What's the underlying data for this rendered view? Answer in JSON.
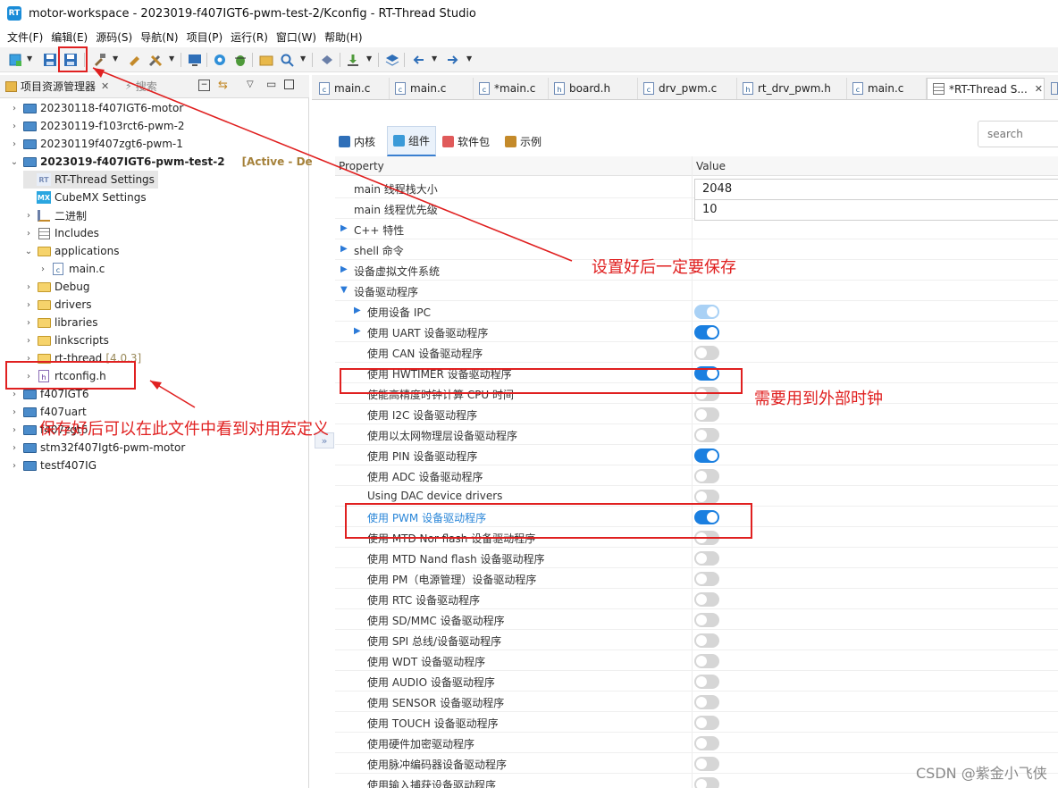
{
  "window": {
    "title": "motor-workspace - 2023019-f407IGT6-pwm-test-2/Kconfig - RT-Thread Studio",
    "logo_text": "RT"
  },
  "menubar": [
    "文件(F)",
    "编辑(E)",
    "源码(S)",
    "导航(N)",
    "项目(P)",
    "运行(R)",
    "窗口(W)",
    "帮助(H)"
  ],
  "toolbar": {
    "icons": [
      "new-icon",
      "save-icon",
      "save-all-icon",
      "build-icon",
      "clean-icon",
      "tools-icon",
      "terminal-icon",
      "settings-icon",
      "debug-icon",
      "open-folder-icon",
      "search-icon",
      "sdk-icon",
      "download-icon",
      "layers-icon",
      "back-icon",
      "forward-icon"
    ]
  },
  "left_panel": {
    "tab_label": "项目资源管理器",
    "tab_close": "✕",
    "search_tab": "搜索",
    "tree": [
      {
        "label": "20230118-f407IGT6-motor",
        "type": "project"
      },
      {
        "label": "20230119-f103rct6-pwm-2",
        "type": "project"
      },
      {
        "label": "20230119f407zgt6-pwm-1",
        "type": "project"
      },
      {
        "label": "2023019-f407IGT6-pwm-test-2",
        "type": "project",
        "badge": "[Active - Debug]"
      },
      {
        "label": "RT-Thread Settings",
        "type": "rt-settings",
        "icon_text": "RT"
      },
      {
        "label": "CubeMX Settings",
        "type": "cubemx",
        "icon_text": "MX"
      },
      {
        "label": "二进制",
        "type": "binaries"
      },
      {
        "label": "Includes",
        "type": "includes"
      },
      {
        "label": "applications",
        "type": "folder"
      },
      {
        "label": "main.c",
        "type": "cfile",
        "icon_text": "c"
      },
      {
        "label": "Debug",
        "type": "folder"
      },
      {
        "label": "drivers",
        "type": "folder"
      },
      {
        "label": "libraries",
        "type": "folder"
      },
      {
        "label": "linkscripts",
        "type": "folder"
      },
      {
        "label": "rt-thread",
        "type": "folder",
        "suffix": "[4.0.3]"
      },
      {
        "label": "rtconfig.h",
        "type": "hfile",
        "icon_text": "h"
      },
      {
        "label": "f407IGT6",
        "type": "project"
      },
      {
        "label": "f407uart",
        "type": "project"
      },
      {
        "label": "f407zgt6",
        "type": "project"
      },
      {
        "label": "stm32f407Igt6-pwm-motor",
        "type": "project"
      },
      {
        "label": "testf407IG",
        "type": "project"
      }
    ]
  },
  "editor_tabs": [
    {
      "label": "main.c",
      "icon": "c"
    },
    {
      "label": "main.c",
      "icon": "c"
    },
    {
      "label": "*main.c",
      "icon": "c"
    },
    {
      "label": "board.h",
      "icon": "h"
    },
    {
      "label": "drv_pwm.c",
      "icon": "c"
    },
    {
      "label": "rt_drv_pwm.h",
      "icon": "h"
    },
    {
      "label": "main.c",
      "icon": "c"
    },
    {
      "label": "*RT-Thread S...",
      "icon": "rt",
      "active": true,
      "close": "✕"
    }
  ],
  "settings": {
    "tabs": [
      {
        "label": "内核",
        "icon": "kernel-icon"
      },
      {
        "label": "组件",
        "icon": "component-icon",
        "active": true
      },
      {
        "label": "软件包",
        "icon": "package-icon"
      },
      {
        "label": "示例",
        "icon": "example-icon"
      }
    ],
    "search_placeholder": "search",
    "columns": {
      "property": "Property",
      "value": "Value"
    },
    "collapse_glyph": "»",
    "rows": [
      {
        "label": "main 线程栈大小",
        "value": "2048"
      },
      {
        "label": "main 线程优先级",
        "value": "10"
      },
      {
        "label": "C++ 特性",
        "expander": "collapsed"
      },
      {
        "label": "shell 命令",
        "expander": "collapsed"
      },
      {
        "label": "设备虚拟文件系统",
        "expander": "collapsed"
      },
      {
        "label": "设备驱动程序",
        "expander": "expanded"
      },
      {
        "label": "使用设备 IPC",
        "expander": "collapsed",
        "toggle": "half"
      },
      {
        "label": "使用 UART 设备驱动程序",
        "expander": "collapsed",
        "toggle": "on"
      },
      {
        "label": "使用 CAN 设备驱动程序",
        "toggle": "off"
      },
      {
        "label": "使用 HWTIMER 设备驱动程序",
        "toggle": "on"
      },
      {
        "label": "使能高精度时钟计算 CPU 时间",
        "toggle": "off"
      },
      {
        "label": "使用 I2C 设备驱动程序",
        "toggle": "off"
      },
      {
        "label": "使用以太网物理层设备驱动程序",
        "toggle": "off"
      },
      {
        "label": "使用 PIN 设备驱动程序",
        "toggle": "on"
      },
      {
        "label": "使用 ADC 设备驱动程序",
        "toggle": "off"
      },
      {
        "label": "Using DAC device drivers",
        "toggle": "off"
      },
      {
        "label": "使用 PWM 设备驱动程序",
        "toggle": "on",
        "highlight": true
      },
      {
        "label": "使用 MTD Nor flash 设备驱动程序",
        "toggle": "off"
      },
      {
        "label": "使用 MTD Nand flash 设备驱动程序",
        "toggle": "off"
      },
      {
        "label": "使用 PM（电源管理）设备驱动程序",
        "toggle": "off"
      },
      {
        "label": "使用 RTC 设备驱动程序",
        "toggle": "off"
      },
      {
        "label": "使用 SD/MMC 设备驱动程序",
        "toggle": "off"
      },
      {
        "label": "使用 SPI 总线/设备驱动程序",
        "toggle": "off"
      },
      {
        "label": "使用 WDT 设备驱动程序",
        "toggle": "off"
      },
      {
        "label": "使用 AUDIO 设备驱动程序",
        "toggle": "off"
      },
      {
        "label": "使用 SENSOR 设备驱动程序",
        "toggle": "off"
      },
      {
        "label": "使用 TOUCH 设备驱动程序",
        "toggle": "off"
      },
      {
        "label": "使用硬件加密驱动程序",
        "toggle": "off"
      },
      {
        "label": "使用脉冲编码器设备驱动程序",
        "toggle": "off"
      },
      {
        "label": "使用输入捕获设备驱动程序",
        "toggle": "off"
      }
    ]
  },
  "annotations": {
    "save_note": "设置好后一定要保存",
    "clock_note": "需要用到外部时钟",
    "rtconfig_note": "保存好后可以在此文件中看到对用宏定义",
    "color": "#e02020"
  },
  "watermark": "CSDN @紫金小飞侠"
}
